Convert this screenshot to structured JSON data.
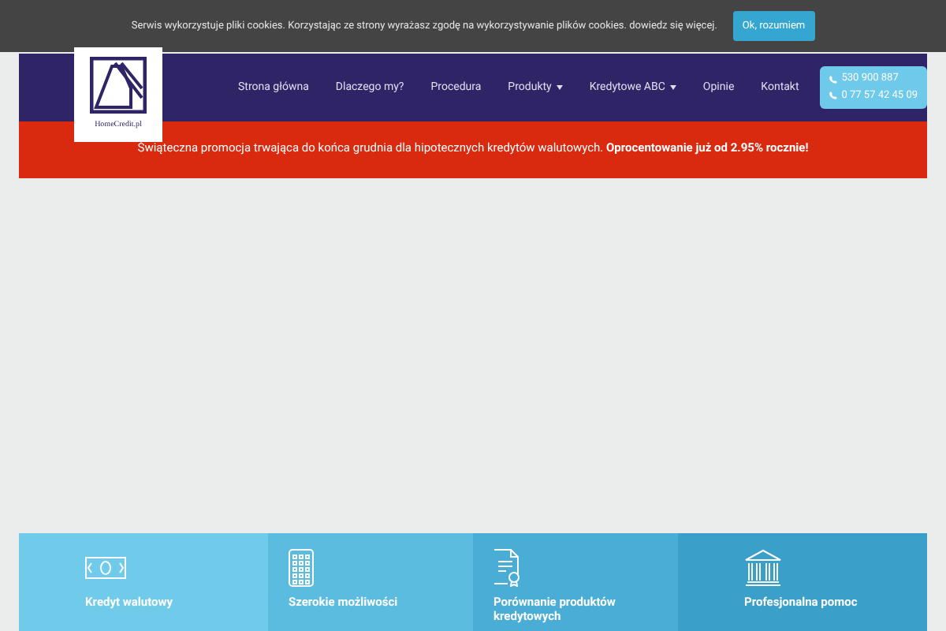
{
  "cookie_bar": {
    "text": "Serwis wykorzystuje pliki cookies. Korzystając ze strony wyrażasz zgodę na wykorzystywanie plików cookies.",
    "link": "dowiedz się więcej.",
    "button": "Ok, rozumiem"
  },
  "logo": {
    "text": "HomeCredit.pl"
  },
  "nav": [
    {
      "label": "Strona główna",
      "dropdown": false
    },
    {
      "label": "Dlaczego my?",
      "dropdown": false
    },
    {
      "label": "Procedura",
      "dropdown": false
    },
    {
      "label": "Produkty",
      "dropdown": true
    },
    {
      "label": "Kredytowe ABC",
      "dropdown": true
    },
    {
      "label": "Opinie",
      "dropdown": false
    },
    {
      "label": "Kontakt",
      "dropdown": false
    }
  ],
  "phones": [
    "530 900 887",
    "0 77 57 42 45 09"
  ],
  "promo": "Świąteczna promocja trwająca do końca grudnia dla hipotecznych kredytów walutowych. **Oprocentowanie już od 2.95% rocznie!**",
  "features": [
    {
      "kind": "banknote",
      "title": "Kredyt walutowy",
      "color": "#6fcbe9"
    },
    {
      "kind": "calculator",
      "title": "Szerokie możliwości",
      "color": "#5bbcdf"
    },
    {
      "kind": "certificate",
      "title": "Porównanie produktów kredytowych",
      "color": "#4aadd5"
    },
    {
      "kind": "bank",
      "title": "Profesjonalna pomoc",
      "color": "#3a9fc9"
    }
  ]
}
